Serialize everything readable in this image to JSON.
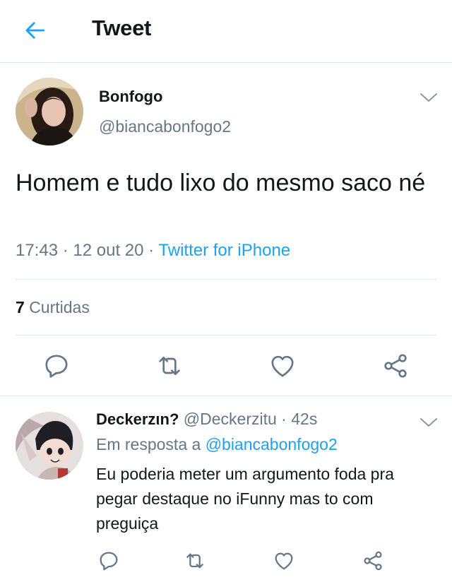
{
  "header": {
    "title": "Tweet",
    "back_icon": "back-arrow-icon"
  },
  "colors": {
    "accent": "#1da1f2",
    "secondary_text": "#657786",
    "divider": "#e1e8ed"
  },
  "tweet": {
    "author_name": "Bonfogo",
    "author_handle": "@biancabonfogo2",
    "text": "Homem e tudo lixo do mesmo saco né",
    "time": "17:43",
    "date": "12 out 20",
    "source": "Twitter for iPhone",
    "likes_count": "7",
    "likes_label": "Curtidas",
    "actions": [
      "reply-icon",
      "retweet-icon",
      "like-icon",
      "share-icon"
    ]
  },
  "reply": {
    "author_name": "Deckerzιn?",
    "author_handle": "@Deckerzitu",
    "age": "42s",
    "replying_prefix": "Em resposta a",
    "replying_to": "@biancabonfogo2",
    "text": "Eu poderia meter um argumento foda pra pegar destaque no iFunny mas to com preguiça",
    "actions": [
      "reply-icon",
      "retweet-icon",
      "like-icon",
      "share-icon"
    ]
  }
}
